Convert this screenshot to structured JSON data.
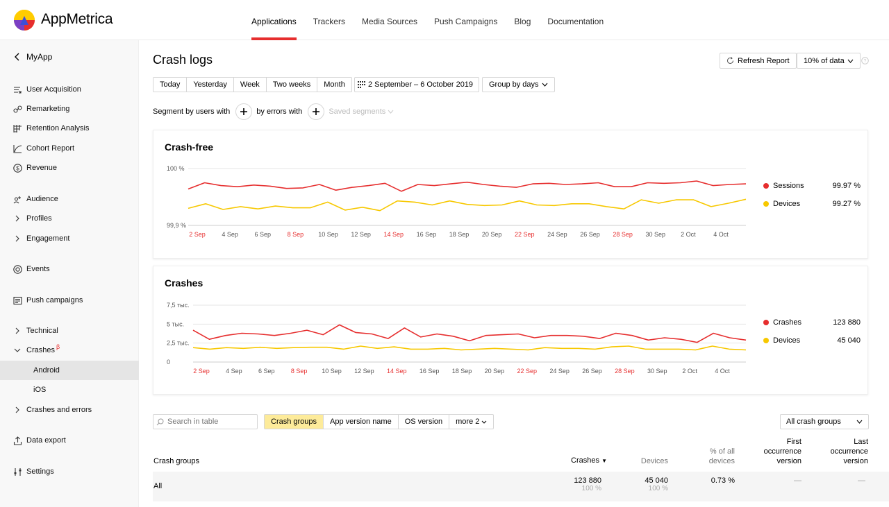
{
  "brand": {
    "name": "AppMetrica"
  },
  "nav": [
    "Applications",
    "Trackers",
    "Media Sources",
    "Push Campaigns",
    "Blog",
    "Documentation"
  ],
  "sidebar": {
    "back_label": "MyApp",
    "items": [
      {
        "label": "User Acquisition",
        "icon": "user-acquisition-icon"
      },
      {
        "label": "Remarketing",
        "icon": "link-icon"
      },
      {
        "label": "Retention Analysis",
        "icon": "grid-icon"
      },
      {
        "label": "Cohort Report",
        "icon": "cohort-icon"
      },
      {
        "label": "Revenue",
        "icon": "dollar-icon"
      },
      {
        "label": "Audience",
        "icon": "audience-icon"
      },
      {
        "label": "Profiles",
        "icon": "chevron-right-icon"
      },
      {
        "label": "Engagement",
        "icon": "chevron-right-icon"
      },
      {
        "label": "Events",
        "icon": "target-icon"
      },
      {
        "label": "Push campaigns",
        "icon": "message-icon"
      },
      {
        "label": "Technical",
        "icon": "chevron-right-icon"
      },
      {
        "label": "Crashes",
        "icon": "chevron-down-icon",
        "sup": "β"
      },
      {
        "label": "Android",
        "icon": ""
      },
      {
        "label": "iOS",
        "icon": ""
      },
      {
        "label": "Crashes and errors",
        "icon": "chevron-right-icon"
      },
      {
        "label": "Data export",
        "icon": "export-icon"
      },
      {
        "label": "Settings",
        "icon": "settings-icon"
      }
    ]
  },
  "page": {
    "title": "Crash logs",
    "refresh_label": "Refresh Report",
    "sampling_label": "10% of data",
    "periods": [
      "Today",
      "Yesterday",
      "Week",
      "Two weeks",
      "Month"
    ],
    "date_range": "2 September – 6 October 2019",
    "group_by": "Group by days",
    "segment": {
      "by_users": "Segment by users with",
      "by_errors": "by errors with",
      "saved": "Saved segments"
    }
  },
  "crash_free": {
    "title": "Crash-free",
    "legend": [
      {
        "name": "Sessions",
        "value": "99.97 %",
        "color": "#e62e2e"
      },
      {
        "name": "Devices",
        "value": "99.27 %",
        "color": "#f7c800"
      }
    ]
  },
  "crashes_card": {
    "title": "Crashes",
    "legend": [
      {
        "name": "Crashes",
        "value": "123 880",
        "color": "#e62e2e"
      },
      {
        "name": "Devices",
        "value": "45 040",
        "color": "#f7c800"
      }
    ]
  },
  "chart_data": [
    {
      "type": "line",
      "title": "Crash-free",
      "x_labels": [
        "2 Sep",
        "4 Sep",
        "6 Sep",
        "8 Sep",
        "10 Sep",
        "12 Sep",
        "14 Sep",
        "16 Sep",
        "18 Sep",
        "20 Sep",
        "22 Sep",
        "24 Sep",
        "26 Sep",
        "28 Sep",
        "30 Sep",
        "2 Oct",
        "4 Oct"
      ],
      "x_labels_red": [
        "2 Sep",
        "8 Sep",
        "14 Sep",
        "22 Sep",
        "28 Sep"
      ],
      "y_ticks": [
        "99,9 %",
        "100 %"
      ],
      "ylim": [
        99.9,
        100
      ],
      "series": [
        {
          "name": "Sessions",
          "color": "#e62e2e",
          "values": [
            99.964,
            99.975,
            99.97,
            99.968,
            99.971,
            99.969,
            99.965,
            99.966,
            99.972,
            99.962,
            99.967,
            99.97,
            99.974,
            99.96,
            99.972,
            99.97,
            99.973,
            99.976,
            99.972,
            99.969,
            99.967,
            99.973,
            99.974,
            99.972,
            99.973,
            99.975,
            99.968,
            99.968,
            99.975,
            99.974,
            99.975,
            99.978,
            99.97,
            99.972,
            99.973
          ]
        },
        {
          "name": "Devices",
          "color": "#f7c800",
          "values": [
            99.93,
            99.938,
            99.928,
            99.933,
            99.929,
            99.934,
            99.931,
            99.931,
            99.941,
            99.927,
            99.932,
            99.926,
            99.943,
            99.941,
            99.936,
            99.943,
            99.937,
            99.935,
            99.936,
            99.943,
            99.936,
            99.935,
            99.938,
            99.938,
            99.933,
            99.929,
            99.945,
            99.939,
            99.945,
            99.945,
            99.933,
            99.939,
            99.946
          ]
        }
      ]
    },
    {
      "type": "line",
      "title": "Crashes",
      "x_labels": [
        "2 Sep",
        "4 Sep",
        "6 Sep",
        "8 Sep",
        "10 Sep",
        "12 Sep",
        "14 Sep",
        "16 Sep",
        "18 Sep",
        "20 Sep",
        "22 Sep",
        "24 Sep",
        "26 Sep",
        "28 Sep",
        "30 Sep",
        "2 Oct",
        "4 Oct"
      ],
      "x_labels_red": [
        "2 Sep",
        "8 Sep",
        "14 Sep",
        "22 Sep",
        "28 Sep"
      ],
      "y_ticks": [
        "0",
        "2,5 тыс.",
        "5 тыс.",
        "7,5 тыс."
      ],
      "ylim": [
        0,
        7500
      ],
      "series": [
        {
          "name": "Crashes",
          "color": "#e62e2e",
          "values": [
            4200,
            3000,
            3500,
            3800,
            3700,
            3500,
            3800,
            4200,
            3600,
            4900,
            3900,
            3700,
            3100,
            4500,
            3300,
            3700,
            3400,
            2800,
            3500,
            3600,
            3700,
            3200,
            3500,
            3500,
            3400,
            3100,
            3800,
            3500,
            2900,
            3200,
            3000,
            2600,
            3800,
            3200,
            2900
          ]
        },
        {
          "name": "Devices",
          "color": "#f7c800",
          "values": [
            1900,
            1700,
            1900,
            1800,
            1950,
            1800,
            1900,
            1950,
            1950,
            1700,
            2100,
            1800,
            2000,
            1700,
            1700,
            1800,
            1600,
            1700,
            1800,
            1700,
            1600,
            1900,
            1800,
            1800,
            1700,
            2000,
            2100,
            1700,
            1700,
            1700,
            1600,
            2100,
            1700,
            1600
          ]
        }
      ]
    }
  ],
  "table": {
    "search_placeholder": "Search in table",
    "tabs": [
      "Crash groups",
      "App version name",
      "OS version",
      "more 2"
    ],
    "filter": "All crash groups",
    "headers": {
      "group": "Crash groups",
      "crashes": "Crashes",
      "devices": "Devices",
      "pct": [
        "% of all",
        "devices"
      ],
      "first": [
        "First",
        "occurrence",
        "version"
      ],
      "last": [
        "Last",
        "occurrence",
        "version"
      ]
    },
    "rows": [
      {
        "group": "All",
        "crashes": "123 880",
        "crashes_pct": "100 %",
        "devices": "45 040",
        "devices_pct": "100 %",
        "pct": "0.73 %",
        "first": "—",
        "last": "—"
      }
    ]
  }
}
